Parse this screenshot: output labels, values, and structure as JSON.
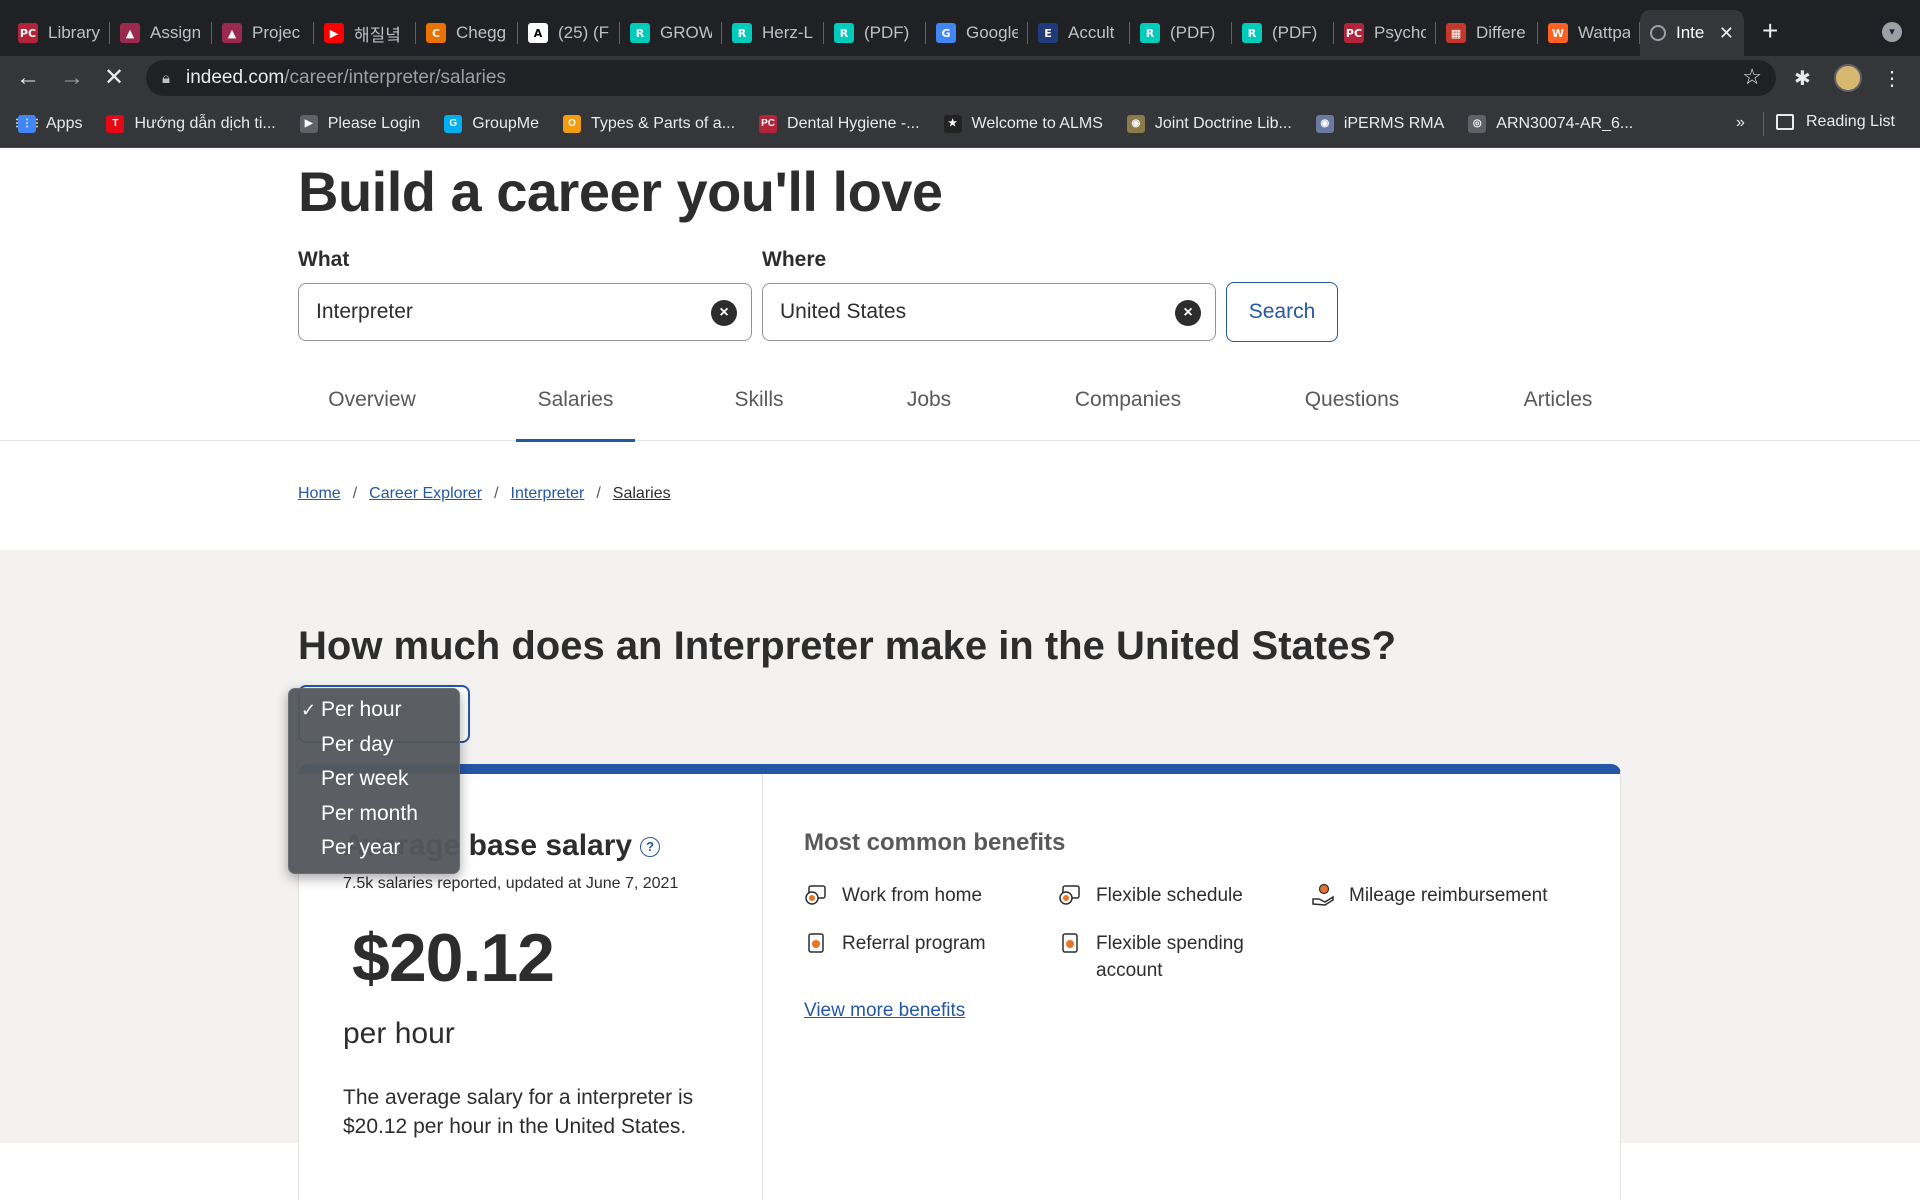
{
  "browser": {
    "tabs": [
      {
        "label": "Library",
        "icon": "PC",
        "color": "#b3243a"
      },
      {
        "label": "Assign",
        "icon": "▲",
        "color": "#9c2a4f"
      },
      {
        "label": "Projec",
        "icon": "▲",
        "color": "#9c2a4f"
      },
      {
        "label": "해질녘",
        "icon": "▶",
        "color": "#ff0000"
      },
      {
        "label": "Chegg",
        "icon": "C",
        "color": "#eb7100"
      },
      {
        "label": "(25) (F",
        "icon": "A",
        "color": "#ffffff"
      },
      {
        "label": "GROW",
        "icon": "R",
        "color": "#00ccbb"
      },
      {
        "label": "Herz-L",
        "icon": "R",
        "color": "#00ccbb"
      },
      {
        "label": "(PDF)",
        "icon": "R",
        "color": "#00ccbb"
      },
      {
        "label": "Google",
        "icon": "G",
        "color": "#4285f4"
      },
      {
        "label": "Accult",
        "icon": "E",
        "color": "#1f3b7a"
      },
      {
        "label": "(PDF)",
        "icon": "R",
        "color": "#00ccbb"
      },
      {
        "label": "(PDF)",
        "icon": "R",
        "color": "#00ccbb"
      },
      {
        "label": "Psycho",
        "icon": "PC",
        "color": "#b3243a"
      },
      {
        "label": "Differe",
        "icon": "▦",
        "color": "#c0392b"
      },
      {
        "label": "Wattpa",
        "icon": "W",
        "color": "#ff6122"
      }
    ],
    "active_tab": {
      "label": "Inte",
      "close": "✕"
    },
    "new_tab": "+",
    "url_domain": "indeed.com",
    "url_path": "/career/interpreter/salaries",
    "bookmarks": [
      {
        "label": "Apps",
        "icon": "⋮⋮⋮",
        "color": "#4285f4"
      },
      {
        "label": "Hướng dẫn dịch ti...",
        "icon": "T",
        "color": "#e50914"
      },
      {
        "label": "Please Login",
        "icon": "▶",
        "color": "#ffffff"
      },
      {
        "label": "GroupMe",
        "icon": "G",
        "color": "#00aff0"
      },
      {
        "label": "Types & Parts of a...",
        "icon": "O",
        "color": "#f39c12"
      },
      {
        "label": "Dental Hygiene -...",
        "icon": "PC",
        "color": "#b3243a"
      },
      {
        "label": "Welcome to ALMS",
        "icon": "★",
        "color": "#222222"
      },
      {
        "label": "Joint Doctrine Lib...",
        "icon": "◉",
        "color": "#8b7a4a"
      },
      {
        "label": "iPERMS RMA",
        "icon": "◉",
        "color": "#6b7aa1"
      },
      {
        "label": "ARN30074-AR_6...",
        "icon": "◎",
        "color": "#e8eaed"
      }
    ],
    "bookmarks_more": "»",
    "reading_list": "Reading List"
  },
  "page": {
    "hero_title": "Build a career you'll love",
    "what_label": "What",
    "what_value": "Interpreter",
    "where_label": "Where",
    "where_value": "United States",
    "search_button": "Search",
    "nav_tabs": [
      "Overview",
      "Salaries",
      "Skills",
      "Jobs",
      "Companies",
      "Questions",
      "Articles"
    ],
    "active_nav": "Salaries",
    "breadcrumb": [
      "Home",
      "Career Explorer",
      "Interpreter",
      "Salaries"
    ],
    "section_title": "How much does an Interpreter make in the United States?",
    "pay_period_options": [
      "Per hour",
      "Per day",
      "Per week",
      "Per month",
      "Per year"
    ],
    "pay_period_selected": "Per hour",
    "avg_title": "Average base salary",
    "reported_text": "7.5k salaries reported, updated at June 7, 2021",
    "salary": "$20.12",
    "per_unit": "per hour",
    "summary": "The average salary for a interpreter is $20.12 per hour in the United States.",
    "benefits_title": "Most common benefits",
    "benefits": [
      "Work from home",
      "Flexible schedule",
      "Mileage reimbursement",
      "Referral program",
      "Flexible spending account"
    ],
    "view_more": "View more benefits"
  }
}
